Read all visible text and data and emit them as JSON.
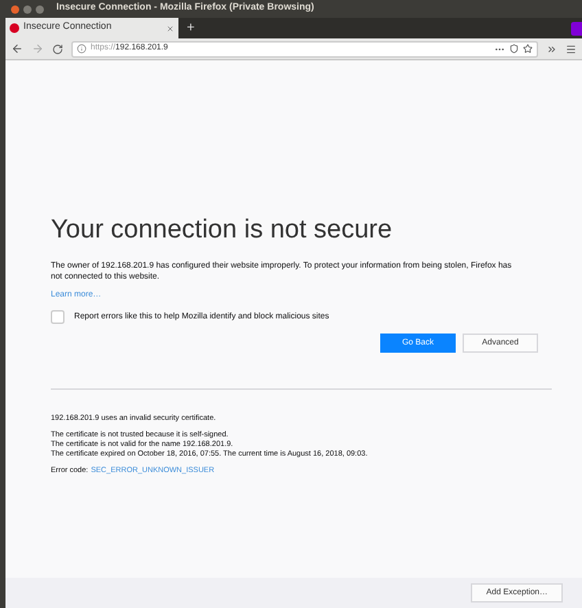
{
  "window": {
    "title": "Insecure Connection - Mozilla Firefox (Private Browsing)"
  },
  "tabs": [
    {
      "label": "Insecure Connection",
      "selected": true
    }
  ],
  "new_tab": "+",
  "url": {
    "scheme": "https://",
    "host": "192.168.201.9"
  },
  "page": {
    "heading": "Your connection is not secure",
    "message": "The owner of 192.168.201.9 has configured their website improperly. To protect your information from being stolen, Firefox has not connected to this website.",
    "learn_more": "Learn more…",
    "report": {
      "label": "Report errors like this to help Mozilla identify and block malicious sites",
      "checked": false
    },
    "buttons": [
      "Go Back",
      "Advanced"
    ]
  },
  "advanced": {
    "intro": "192.168.201.9 uses an invalid security certificate.",
    "details": [
      "The certificate is not trusted because it is self-signed.",
      "The certificate is not valid for the name 192.168.201.9.",
      "The certificate expired on October 18, 2016, 07:55. The current time is August 16, 2018, 09:03."
    ],
    "error_label": "Error code:",
    "error_code": "SEC_ERROR_UNKNOWN_ISSUER",
    "exception_button": "Add Exception…"
  }
}
